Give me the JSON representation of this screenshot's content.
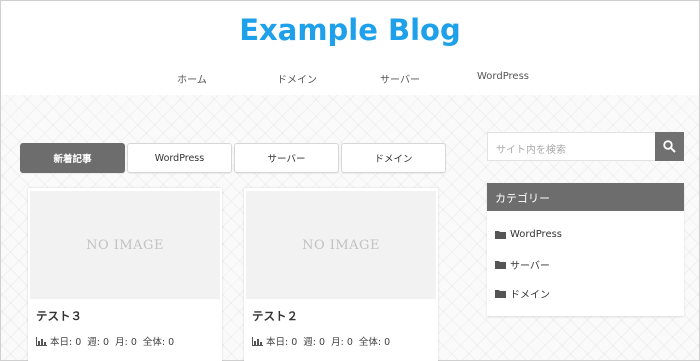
{
  "header": {
    "site_title": "Example Blog",
    "nav": [
      "ホーム",
      "ドメイン",
      "サーバー",
      "WordPress"
    ]
  },
  "tabs": [
    {
      "label": "新着記事",
      "active": true
    },
    {
      "label": "WordPress",
      "active": false
    },
    {
      "label": "サーバー",
      "active": false
    },
    {
      "label": "ドメイン",
      "active": false
    }
  ],
  "posts": [
    {
      "thumb_text": "NO IMAGE",
      "title": "テスト３",
      "stats": "本日: 0  週: 0  月: 0  全体: 0"
    },
    {
      "thumb_text": "NO IMAGE",
      "title": "テスト２",
      "stats": "本日: 0  週: 0  月: 0  全体: 0"
    }
  ],
  "sidebar": {
    "search_placeholder": "サイト内を検索",
    "categories_title": "カテゴリー",
    "categories": [
      "WordPress",
      "サーバー",
      "ドメイン"
    ]
  },
  "colors": {
    "accent": "#1ea0ea",
    "active_tab": "#6d6d6d",
    "widget_header": "#6d6d6d"
  },
  "icons": {
    "search": "search-icon",
    "stats": "bar-chart-icon",
    "folder": "folder-icon"
  }
}
